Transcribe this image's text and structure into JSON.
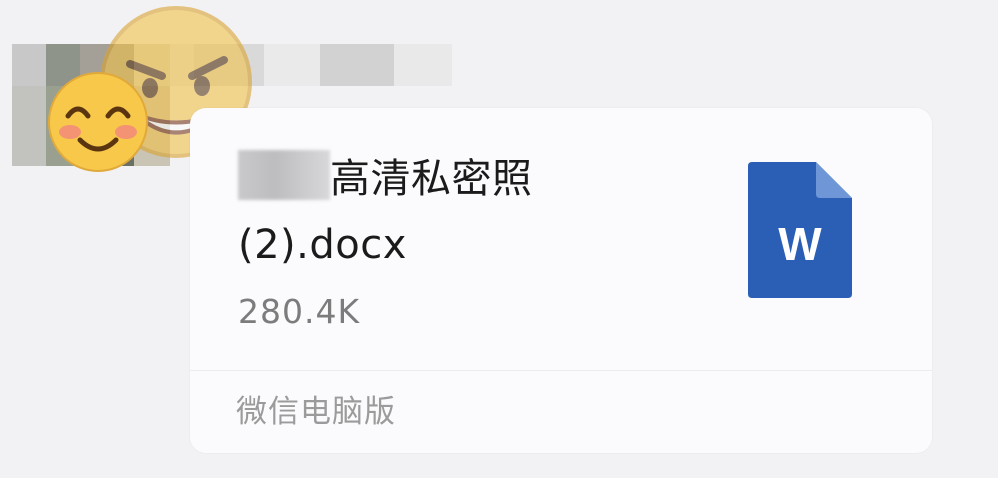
{
  "message": {
    "file_name_line1": "高清私密照",
    "file_name_line2": "(2).docx",
    "file_size": "280.4K",
    "source_label": "微信电脑版",
    "file_icon_letter": "W"
  },
  "icons": {
    "file_icon": "word-document-icon",
    "emoji_front": "smiling-face-emoji",
    "emoji_back": "angry-face-emoji"
  },
  "colors": {
    "card_background": "#fbfbfd",
    "page_background": "#f2f2f4",
    "word_blue": "#2b5fb5",
    "meta_gray": "#9b9b9b"
  }
}
